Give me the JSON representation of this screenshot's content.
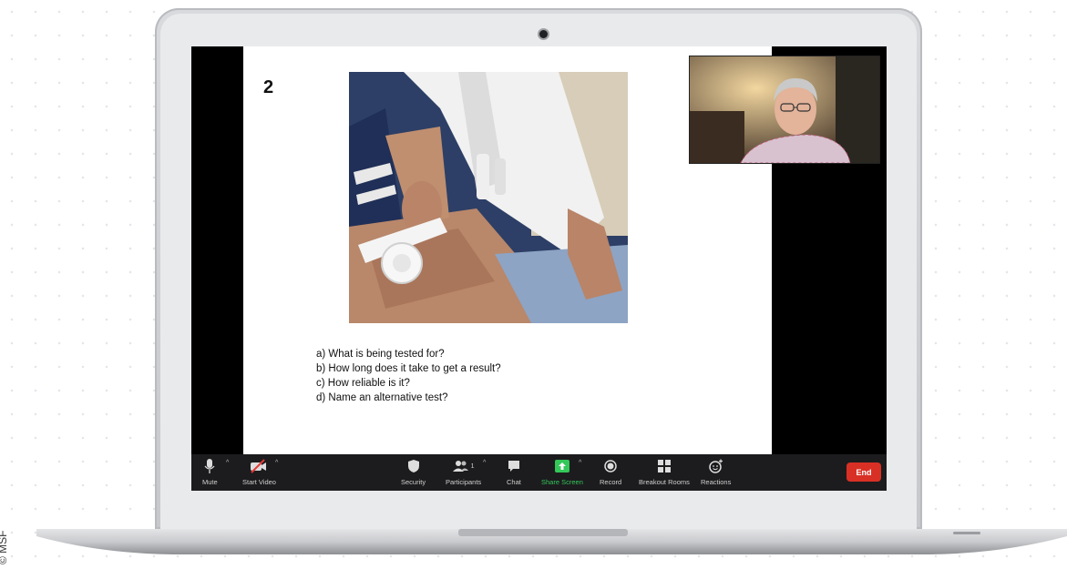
{
  "credit": "© MSF",
  "slide": {
    "number": "2",
    "questions": [
      "a) What is being tested for?",
      "b) How long does it take to get a result?",
      "c) How reliable is it?",
      "d) Name an alternative test?"
    ]
  },
  "toolbar": {
    "mute_label": "Mute",
    "start_video_label": "Start Video",
    "security_label": "Security",
    "participants_label": "Participants",
    "participants_count": "1",
    "chat_label": "Chat",
    "share_screen_label": "Share Screen",
    "record_label": "Record",
    "breakout_rooms_label": "Breakout Rooms",
    "reactions_label": "Reactions",
    "end_label": "End"
  },
  "colors": {
    "toolbar_bg": "#1c1c1e",
    "share_green": "#34c759",
    "end_red": "#d93025"
  }
}
